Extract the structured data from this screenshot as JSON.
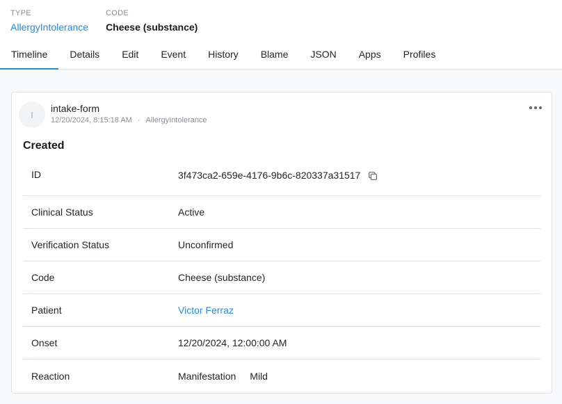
{
  "header": {
    "type_label": "TYPE",
    "type_value": "AllergyIntolerance",
    "code_label": "CODE",
    "code_value": "Cheese (substance)"
  },
  "tabs": [
    {
      "label": "Timeline",
      "active": true
    },
    {
      "label": "Details"
    },
    {
      "label": "Edit"
    },
    {
      "label": "Event"
    },
    {
      "label": "History"
    },
    {
      "label": "Blame"
    },
    {
      "label": "JSON"
    },
    {
      "label": "Apps"
    },
    {
      "label": "Profiles"
    }
  ],
  "event": {
    "avatar_initial": "I",
    "author": "intake-form",
    "timestamp": "12/20/2024, 8:15:18 AM",
    "separator": "·",
    "resource_type": "AllergyIntolerance",
    "heading": "Created",
    "rows": {
      "id": {
        "key": "ID",
        "value": "3f473ca2-659e-4176-9b6c-820337a31517"
      },
      "clinical_status": {
        "key": "Clinical Status",
        "value": "Active"
      },
      "verification_status": {
        "key": "Verification Status",
        "value": "Unconfirmed"
      },
      "code": {
        "key": "Code",
        "value": "Cheese (substance)"
      },
      "patient": {
        "key": "Patient",
        "value": "Victor Ferraz"
      },
      "onset": {
        "key": "Onset",
        "value": "12/20/2024, 12:00:00 AM"
      },
      "reaction": {
        "key": "Reaction",
        "manifestation": "Manifestation",
        "severity": "Mild"
      }
    }
  },
  "colors": {
    "accent": "#228be6",
    "border": "#dee2e6",
    "muted": "#868e96"
  }
}
